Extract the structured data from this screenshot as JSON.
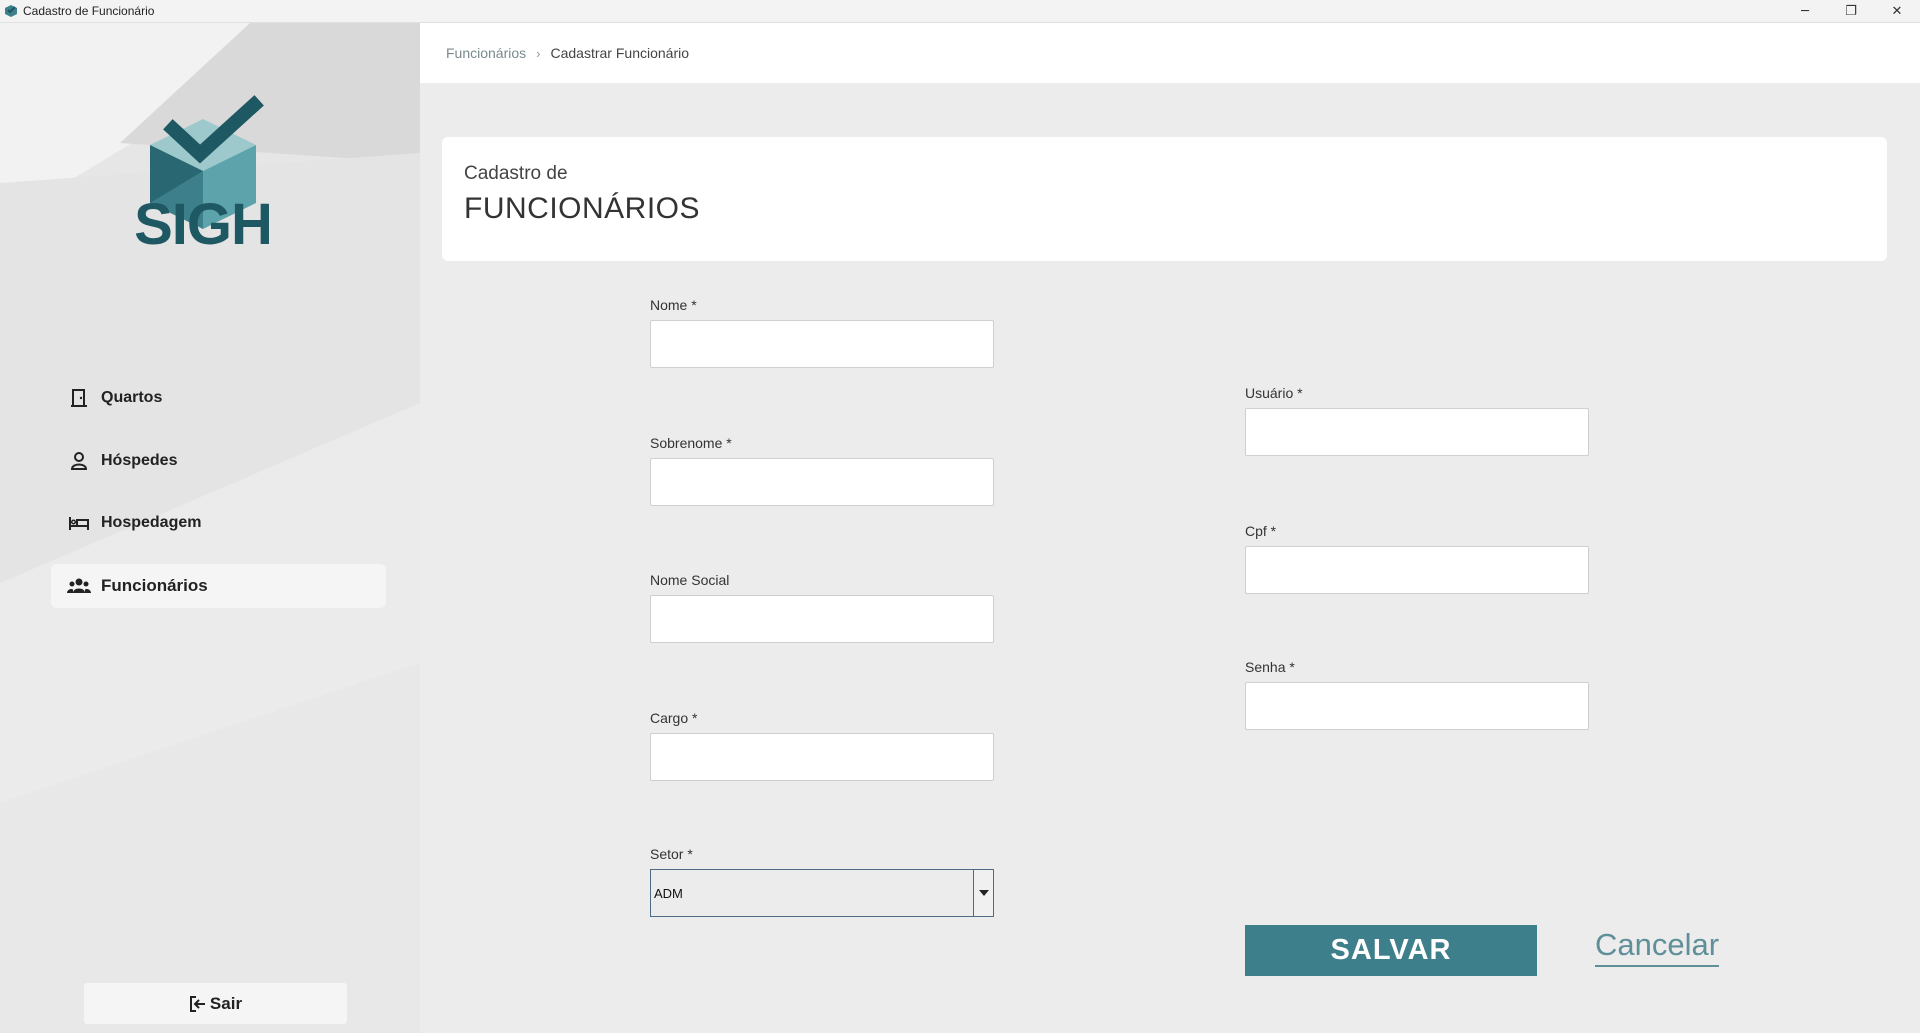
{
  "window": {
    "title": "Cadastro de Funcionário",
    "controls": {
      "minimize": "─",
      "restore": "❐",
      "close": "✕"
    }
  },
  "brand": {
    "logo_text": "SIGH"
  },
  "sidebar": {
    "items": [
      {
        "label": "Quartos",
        "icon": "door-icon"
      },
      {
        "label": "Hóspedes",
        "icon": "person-icon"
      },
      {
        "label": "Hospedagem",
        "icon": "bed-icon"
      },
      {
        "label": "Funcionários",
        "icon": "group-icon",
        "active": true
      }
    ],
    "exit_label": "Sair"
  },
  "breadcrumb": {
    "parent": "Funcionários",
    "separator": "›",
    "current": "Cadastrar Funcionário"
  },
  "header": {
    "subtitle": "Cadastro de",
    "title": "FUNCIONÁRIOS"
  },
  "form": {
    "nome": {
      "label": "Nome *",
      "value": ""
    },
    "sobrenome": {
      "label": "Sobrenome *",
      "value": ""
    },
    "nome_social": {
      "label": "Nome Social",
      "value": ""
    },
    "cargo": {
      "label": "Cargo *",
      "value": ""
    },
    "setor": {
      "label": "Setor *",
      "value": "ADM"
    },
    "usuario": {
      "label": "Usuário *",
      "value": ""
    },
    "cpf": {
      "label": "Cpf *",
      "value": ""
    },
    "senha": {
      "label": "Senha *",
      "value": ""
    }
  },
  "actions": {
    "save_label": "SALVAR",
    "cancel_label": "Cancelar"
  },
  "colors": {
    "accent": "#3d7f8b",
    "brand_dark": "#1d5863",
    "cancel_link": "#5f8f99"
  }
}
